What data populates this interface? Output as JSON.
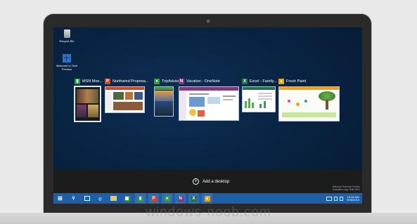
{
  "desktop": {
    "icons": [
      {
        "label": "Recycle Bin",
        "icon": "recycle-bin-icon"
      },
      {
        "label": "Welcome to Tech Preview",
        "icon": "windows-icon"
      }
    ]
  },
  "task_view": {
    "windows": [
      {
        "title": "MSN Mon...",
        "icon_letter": "",
        "accent": "#2f9a3c"
      },
      {
        "title": "Northwind Proposa...",
        "icon_letter": "P",
        "accent": "#d24726"
      },
      {
        "title": "TripAdvisor",
        "icon_letter": "",
        "accent": "#3d9a3d"
      },
      {
        "title": "Vacation - OneNote",
        "icon_letter": "N",
        "accent": "#80397b"
      },
      {
        "title": "Excel - Family...",
        "icon_letter": "X",
        "accent": "#217346"
      },
      {
        "title": "Fresh Paint",
        "icon_letter": "",
        "accent": "#f2a10c"
      }
    ],
    "add_desktop_label": "Add a desktop"
  },
  "watermark": {
    "line1": "Windows Technical Preview",
    "line2": "Evaluation copy. Build 9841"
  },
  "clock": {
    "time": "10:24 AM",
    "date": "9/30/2014"
  },
  "site_watermark": "windows-noob.com",
  "colors": {
    "desktop": "#082240",
    "taskbar": "#1f5fa8",
    "bottom_bar": "#1c1c1c",
    "selected_border": "#ffffff"
  }
}
